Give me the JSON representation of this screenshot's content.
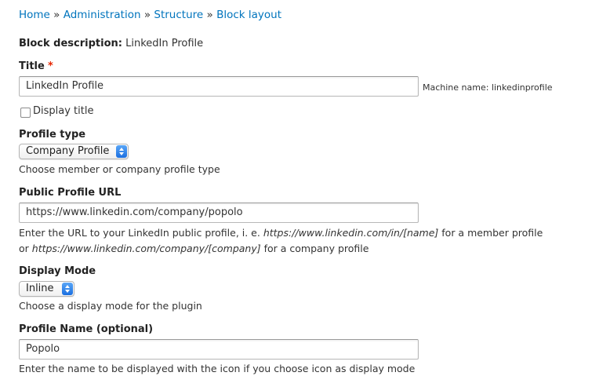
{
  "breadcrumb": {
    "items": [
      "Home",
      "Administration",
      "Structure",
      "Block layout"
    ],
    "separator": "»"
  },
  "block_description": {
    "label": "Block description:",
    "value": "LinkedIn Profile"
  },
  "title_field": {
    "label": "Title",
    "required_marker": "*",
    "value": "LinkedIn Profile",
    "machine_name": "Machine name: linkedinprofile"
  },
  "display_title": {
    "label": "Display title",
    "checked": false
  },
  "profile_type": {
    "label": "Profile type",
    "selected": "Company Profile",
    "description": "Choose member or company profile type"
  },
  "public_profile_url": {
    "label": "Public Profile URL",
    "value": "https://www.linkedin.com/company/popolo",
    "description_line1_pre": "Enter the URL to your LinkedIn public profile, i. e. ",
    "description_line1_em": "https://www.linkedin.com/in/[name]",
    "description_line1_post": " for a member profile",
    "description_line2_pre": "or ",
    "description_line2_em": "https://www.linkedin.com/company/[company]",
    "description_line2_post": " for a company profile"
  },
  "display_mode": {
    "label": "Display Mode",
    "selected": "Inline",
    "description": "Choose a display mode for the plugin"
  },
  "profile_name": {
    "label": "Profile Name (optional)",
    "value": "Popolo",
    "description": "Enter the name to be displayed with the icon if you choose icon as display mode"
  },
  "colors": {
    "link": "#0074bd",
    "required": "#e62600",
    "select_accent": "#1b6fe0"
  }
}
